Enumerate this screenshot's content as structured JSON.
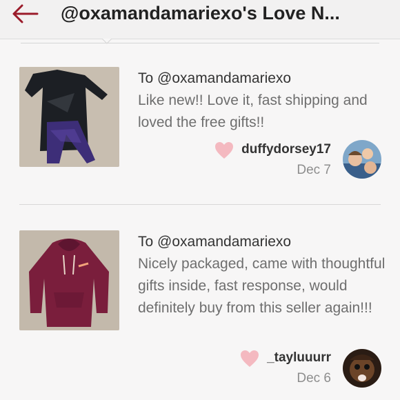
{
  "header": {
    "title": "@oxamandamariexo's Love N...",
    "back_icon": "back-arrow-icon"
  },
  "colors": {
    "accent": "#9b1b2a",
    "heart": "#f4b9c0",
    "text_muted": "#6e6e6e"
  },
  "reviews": [
    {
      "to": "To @oxamandamariexo",
      "text": "Like new!! Love it, fast shipping and loved the free gifts!!",
      "username": "duffydorsey17",
      "date": "Dec 7",
      "like_icon": "heart-icon",
      "photo_subject": "black Nike long-sleeve top and purple leggings"
    },
    {
      "to": "To @oxamandamariexo",
      "text": "Nicely packaged, came with thoughtful gifts inside, fast response, would definitely buy from this seller again!!!",
      "username": "_tayluuurr",
      "date": "Dec 6",
      "like_icon": "heart-icon",
      "photo_subject": "maroon Nike hoodie"
    }
  ]
}
